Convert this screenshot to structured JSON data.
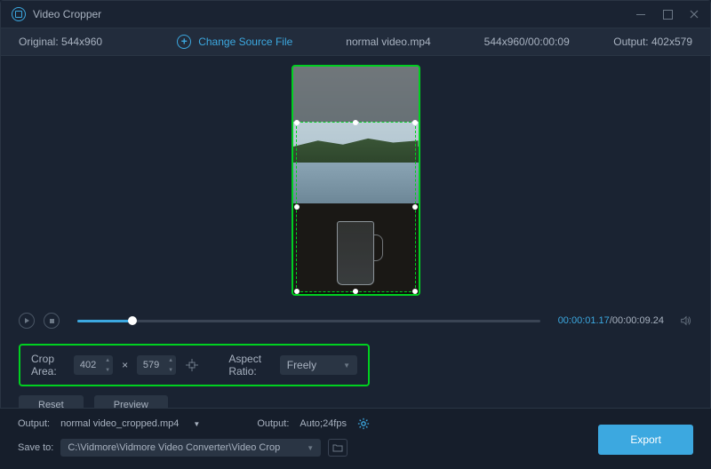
{
  "title": "Video Cropper",
  "header": {
    "original_label": "Original:",
    "original_dims": "544x960",
    "change_source": "Change Source File",
    "filename": "normal video.mp4",
    "source_info": "544x960/00:00:09",
    "output_label": "Output:",
    "output_dims": "402x579"
  },
  "playback": {
    "current": "00:00:01.17",
    "total": "00:00:09.24"
  },
  "crop": {
    "area_label": "Crop Area:",
    "width": "402",
    "height": "579",
    "x_sep": "×",
    "ratio_label": "Aspect Ratio:",
    "ratio_value": "Freely"
  },
  "actions": {
    "reset": "Reset",
    "preview": "Preview"
  },
  "output": {
    "label1": "Output:",
    "file": "normal video_cropped.mp4",
    "label2": "Output:",
    "settings": "Auto;24fps"
  },
  "save": {
    "label": "Save to:",
    "path": "C:\\Vidmore\\Vidmore Video Converter\\Video Crop"
  },
  "export": "Export"
}
